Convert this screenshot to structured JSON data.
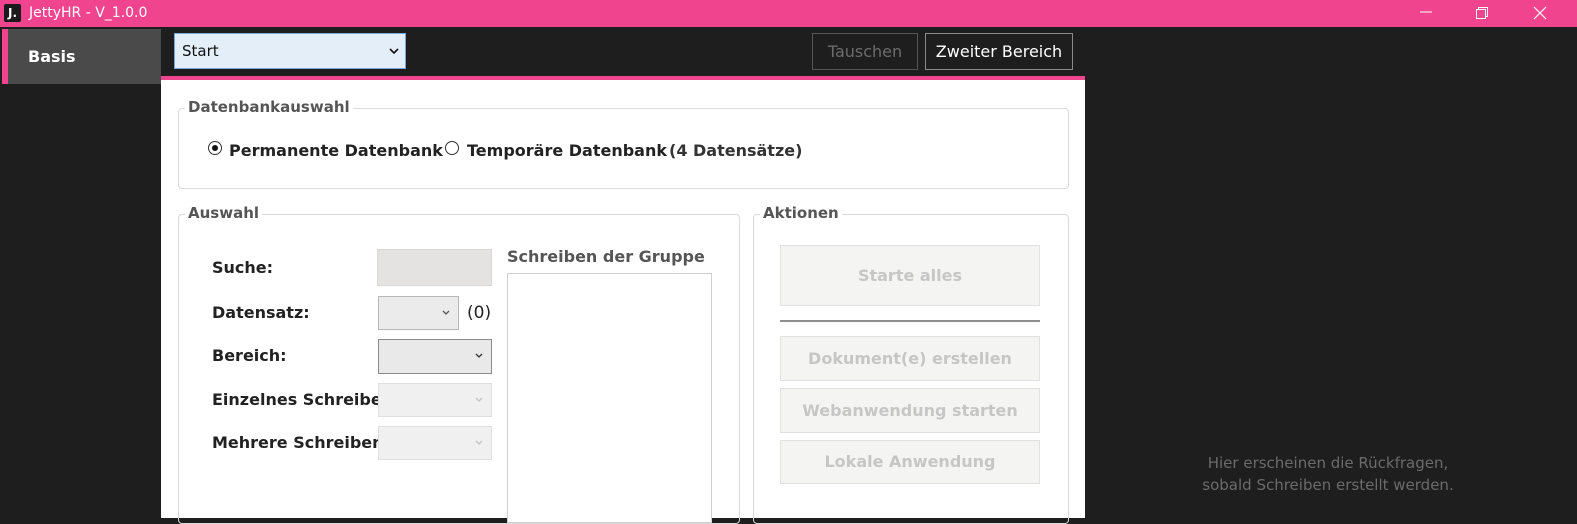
{
  "window": {
    "title": "JettyHR - V_1.0.0",
    "logo_letter": "J."
  },
  "sidebar": {
    "items": [
      {
        "label": "Basis"
      }
    ]
  },
  "toolbar": {
    "select_value": "Start",
    "tauschen_label": "Tauschen",
    "zweiter_label": "Zweiter Bereich"
  },
  "datenbank": {
    "legend": "Datenbankauswahl",
    "permanent_label": "Permanente Datenbank",
    "temporary_label": "Temporäre Datenbank",
    "count_text": "(4 Datensätze)"
  },
  "auswahl": {
    "legend": "Auswahl",
    "suche_label": "Suche:",
    "suche_value": "",
    "datensatz_label": "Datensatz:",
    "datensatz_count": "(0)",
    "bereich_label": "Bereich:",
    "einzelnes_label": "Einzelnes Schreiben",
    "mehrere_label": "Mehrere Schreiben:",
    "gruppe_label": "Schreiben der Gruppe"
  },
  "aktionen": {
    "legend": "Aktionen",
    "starte_alles": "Starte alles",
    "dokument": "Dokument(e) erstellen",
    "webanwendung": "Webanwendung starten",
    "lokale": "Lokale Anwendung"
  },
  "hint": {
    "line1": "Hier erscheinen die Rückfragen,",
    "line2": "sobald Schreiben erstellt werden."
  },
  "colors": {
    "accent": "#f0448f",
    "background": "#1e1e1e",
    "panel": "#ffffff"
  }
}
